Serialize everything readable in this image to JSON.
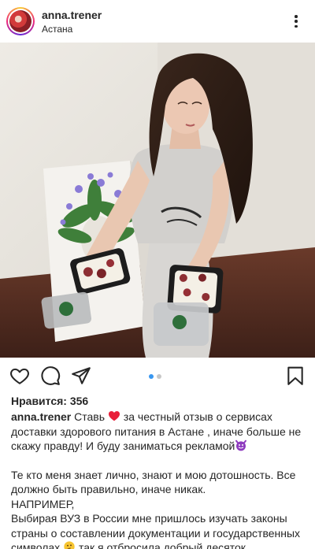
{
  "post": {
    "username": "anna.trener",
    "location": "Астана",
    "likes_label": "Нравится: 356",
    "carousel": {
      "count": 2,
      "active": 1
    },
    "caption": {
      "username": "anna.trener",
      "p1_a": "Ставь",
      "p1_b": "за честный отзыв о сервисах доставки здорового питания в Астане , иначе больше не скажу правду! И буду заниматься рекламой",
      "p2": "Те кто меня знает лично, знают и мою дотошность. Все должно быть правильно, иначе никак.",
      "p3": "НАПРИМЕР,",
      "p4_a": "Выбирая ВУЗ в России мне пришлось изучать законы страны о составлении документации и государственных символах",
      "p4_b": "так я отбросила добрый десяток институтов, из- за неправильного образца"
    }
  },
  "icons": {
    "avatar": "avatar",
    "more": "more-icon",
    "like": "heart-outline-icon",
    "comment": "comment-icon",
    "share": "send-icon",
    "save": "bookmark-icon",
    "heart_emoji": "red-heart-emoji",
    "devil_emoji": "smiling-devil-emoji",
    "thinking_emoji": "thinking-face-emoji"
  },
  "colors": {
    "text": "#262626",
    "accent_dot": "#3897f0",
    "inactive_dot": "#c7c7c7",
    "heart": "#e8203a",
    "devil": "#8e3bbf"
  }
}
